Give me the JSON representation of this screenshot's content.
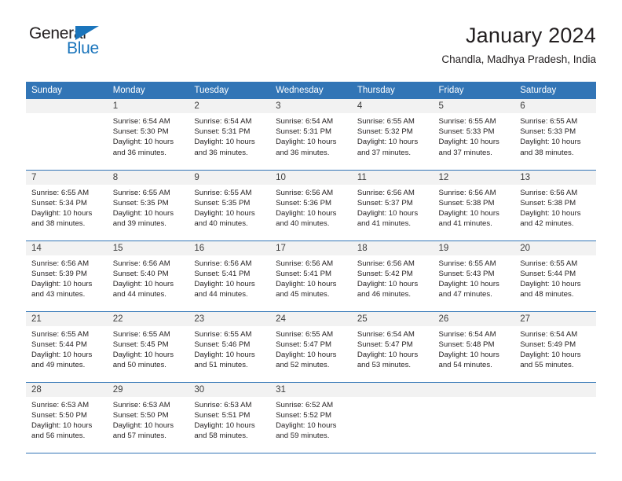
{
  "logo": {
    "word_1": "General",
    "word_2": "Blue",
    "triangle_icon": "triangle-icon",
    "accent_color": "#1b75bc"
  },
  "header": {
    "title": "January 2024",
    "subtitle": "Chandla, Madhya Pradesh, India"
  },
  "calendar": {
    "header_color": "#3275b6",
    "daynum_bg": "#f2f2f2",
    "weekday_headers": [
      "Sunday",
      "Monday",
      "Tuesday",
      "Wednesday",
      "Thursday",
      "Friday",
      "Saturday"
    ],
    "weeks": [
      [
        {
          "day": "",
          "empty": true,
          "sunrise": "",
          "sunset": "",
          "daylight_1": "",
          "daylight_2": ""
        },
        {
          "day": "1",
          "sunrise": "Sunrise: 6:54 AM",
          "sunset": "Sunset: 5:30 PM",
          "daylight_1": "Daylight: 10 hours",
          "daylight_2": "and 36 minutes."
        },
        {
          "day": "2",
          "sunrise": "Sunrise: 6:54 AM",
          "sunset": "Sunset: 5:31 PM",
          "daylight_1": "Daylight: 10 hours",
          "daylight_2": "and 36 minutes."
        },
        {
          "day": "3",
          "sunrise": "Sunrise: 6:54 AM",
          "sunset": "Sunset: 5:31 PM",
          "daylight_1": "Daylight: 10 hours",
          "daylight_2": "and 36 minutes."
        },
        {
          "day": "4",
          "sunrise": "Sunrise: 6:55 AM",
          "sunset": "Sunset: 5:32 PM",
          "daylight_1": "Daylight: 10 hours",
          "daylight_2": "and 37 minutes."
        },
        {
          "day": "5",
          "sunrise": "Sunrise: 6:55 AM",
          "sunset": "Sunset: 5:33 PM",
          "daylight_1": "Daylight: 10 hours",
          "daylight_2": "and 37 minutes."
        },
        {
          "day": "6",
          "sunrise": "Sunrise: 6:55 AM",
          "sunset": "Sunset: 5:33 PM",
          "daylight_1": "Daylight: 10 hours",
          "daylight_2": "and 38 minutes."
        }
      ],
      [
        {
          "day": "7",
          "sunrise": "Sunrise: 6:55 AM",
          "sunset": "Sunset: 5:34 PM",
          "daylight_1": "Daylight: 10 hours",
          "daylight_2": "and 38 minutes."
        },
        {
          "day": "8",
          "sunrise": "Sunrise: 6:55 AM",
          "sunset": "Sunset: 5:35 PM",
          "daylight_1": "Daylight: 10 hours",
          "daylight_2": "and 39 minutes."
        },
        {
          "day": "9",
          "sunrise": "Sunrise: 6:55 AM",
          "sunset": "Sunset: 5:35 PM",
          "daylight_1": "Daylight: 10 hours",
          "daylight_2": "and 40 minutes."
        },
        {
          "day": "10",
          "sunrise": "Sunrise: 6:56 AM",
          "sunset": "Sunset: 5:36 PM",
          "daylight_1": "Daylight: 10 hours",
          "daylight_2": "and 40 minutes."
        },
        {
          "day": "11",
          "sunrise": "Sunrise: 6:56 AM",
          "sunset": "Sunset: 5:37 PM",
          "daylight_1": "Daylight: 10 hours",
          "daylight_2": "and 41 minutes."
        },
        {
          "day": "12",
          "sunrise": "Sunrise: 6:56 AM",
          "sunset": "Sunset: 5:38 PM",
          "daylight_1": "Daylight: 10 hours",
          "daylight_2": "and 41 minutes."
        },
        {
          "day": "13",
          "sunrise": "Sunrise: 6:56 AM",
          "sunset": "Sunset: 5:38 PM",
          "daylight_1": "Daylight: 10 hours",
          "daylight_2": "and 42 minutes."
        }
      ],
      [
        {
          "day": "14",
          "sunrise": "Sunrise: 6:56 AM",
          "sunset": "Sunset: 5:39 PM",
          "daylight_1": "Daylight: 10 hours",
          "daylight_2": "and 43 minutes."
        },
        {
          "day": "15",
          "sunrise": "Sunrise: 6:56 AM",
          "sunset": "Sunset: 5:40 PM",
          "daylight_1": "Daylight: 10 hours",
          "daylight_2": "and 44 minutes."
        },
        {
          "day": "16",
          "sunrise": "Sunrise: 6:56 AM",
          "sunset": "Sunset: 5:41 PM",
          "daylight_1": "Daylight: 10 hours",
          "daylight_2": "and 44 minutes."
        },
        {
          "day": "17",
          "sunrise": "Sunrise: 6:56 AM",
          "sunset": "Sunset: 5:41 PM",
          "daylight_1": "Daylight: 10 hours",
          "daylight_2": "and 45 minutes."
        },
        {
          "day": "18",
          "sunrise": "Sunrise: 6:56 AM",
          "sunset": "Sunset: 5:42 PM",
          "daylight_1": "Daylight: 10 hours",
          "daylight_2": "and 46 minutes."
        },
        {
          "day": "19",
          "sunrise": "Sunrise: 6:55 AM",
          "sunset": "Sunset: 5:43 PM",
          "daylight_1": "Daylight: 10 hours",
          "daylight_2": "and 47 minutes."
        },
        {
          "day": "20",
          "sunrise": "Sunrise: 6:55 AM",
          "sunset": "Sunset: 5:44 PM",
          "daylight_1": "Daylight: 10 hours",
          "daylight_2": "and 48 minutes."
        }
      ],
      [
        {
          "day": "21",
          "sunrise": "Sunrise: 6:55 AM",
          "sunset": "Sunset: 5:44 PM",
          "daylight_1": "Daylight: 10 hours",
          "daylight_2": "and 49 minutes."
        },
        {
          "day": "22",
          "sunrise": "Sunrise: 6:55 AM",
          "sunset": "Sunset: 5:45 PM",
          "daylight_1": "Daylight: 10 hours",
          "daylight_2": "and 50 minutes."
        },
        {
          "day": "23",
          "sunrise": "Sunrise: 6:55 AM",
          "sunset": "Sunset: 5:46 PM",
          "daylight_1": "Daylight: 10 hours",
          "daylight_2": "and 51 minutes."
        },
        {
          "day": "24",
          "sunrise": "Sunrise: 6:55 AM",
          "sunset": "Sunset: 5:47 PM",
          "daylight_1": "Daylight: 10 hours",
          "daylight_2": "and 52 minutes."
        },
        {
          "day": "25",
          "sunrise": "Sunrise: 6:54 AM",
          "sunset": "Sunset: 5:47 PM",
          "daylight_1": "Daylight: 10 hours",
          "daylight_2": "and 53 minutes."
        },
        {
          "day": "26",
          "sunrise": "Sunrise: 6:54 AM",
          "sunset": "Sunset: 5:48 PM",
          "daylight_1": "Daylight: 10 hours",
          "daylight_2": "and 54 minutes."
        },
        {
          "day": "27",
          "sunrise": "Sunrise: 6:54 AM",
          "sunset": "Sunset: 5:49 PM",
          "daylight_1": "Daylight: 10 hours",
          "daylight_2": "and 55 minutes."
        }
      ],
      [
        {
          "day": "28",
          "sunrise": "Sunrise: 6:53 AM",
          "sunset": "Sunset: 5:50 PM",
          "daylight_1": "Daylight: 10 hours",
          "daylight_2": "and 56 minutes."
        },
        {
          "day": "29",
          "sunrise": "Sunrise: 6:53 AM",
          "sunset": "Sunset: 5:50 PM",
          "daylight_1": "Daylight: 10 hours",
          "daylight_2": "and 57 minutes."
        },
        {
          "day": "30",
          "sunrise": "Sunrise: 6:53 AM",
          "sunset": "Sunset: 5:51 PM",
          "daylight_1": "Daylight: 10 hours",
          "daylight_2": "and 58 minutes."
        },
        {
          "day": "31",
          "sunrise": "Sunrise: 6:52 AM",
          "sunset": "Sunset: 5:52 PM",
          "daylight_1": "Daylight: 10 hours",
          "daylight_2": "and 59 minutes."
        },
        {
          "day": "",
          "empty": true,
          "sunrise": "",
          "sunset": "",
          "daylight_1": "",
          "daylight_2": ""
        },
        {
          "day": "",
          "empty": true,
          "sunrise": "",
          "sunset": "",
          "daylight_1": "",
          "daylight_2": ""
        },
        {
          "day": "",
          "empty": true,
          "sunrise": "",
          "sunset": "",
          "daylight_1": "",
          "daylight_2": ""
        }
      ]
    ]
  }
}
